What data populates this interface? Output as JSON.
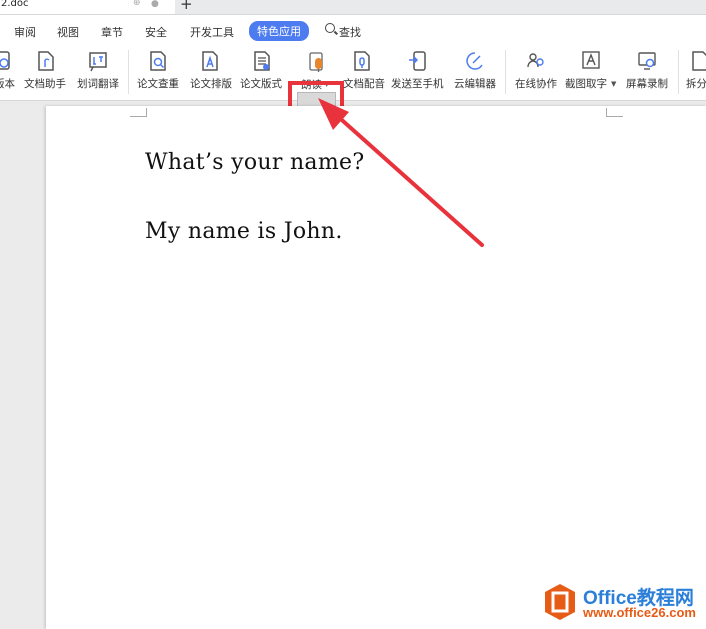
{
  "window": {
    "doc_tab_title": "2.doc",
    "new_tab_label": "+"
  },
  "menu": [
    "审阅",
    "视图",
    "章节",
    "安全",
    "开发工具",
    "特色应用",
    "查找"
  ],
  "ribbon": {
    "items": [
      {
        "label": "版本",
        "icon": "version-icon"
      },
      {
        "label": "文档助手",
        "icon": "document-assistant-icon"
      },
      {
        "label": "划词翻译",
        "icon": "word-translate-icon"
      },
      {
        "label": "论文查重",
        "icon": "paper-check-icon"
      },
      {
        "label": "论文排版",
        "icon": "paper-layout-icon"
      },
      {
        "label": "论文版式",
        "icon": "paper-format-icon"
      },
      {
        "label": "朗读",
        "icon": "read-aloud-icon"
      },
      {
        "label": "文档配音",
        "icon": "document-dubbing-icon"
      },
      {
        "label": "发送至手机",
        "icon": "send-to-phone-icon"
      },
      {
        "label": "云编辑器",
        "icon": "cloud-editor-icon"
      },
      {
        "label": "在线协作",
        "icon": "online-collaboration-icon"
      },
      {
        "label": "截图取字",
        "icon": "screenshot-ocr-icon"
      },
      {
        "label": "屏幕录制",
        "icon": "screen-record-icon"
      },
      {
        "label": "拆分",
        "icon": "split-icon"
      }
    ]
  },
  "document": {
    "lines": [
      "What’s your name?",
      "My name is John."
    ]
  },
  "watermark": {
    "name": "Office教程网",
    "url": "www.office26.com"
  },
  "colors": {
    "accent": "#4d7cf0",
    "highlight": "#e8323c",
    "brand_blue": "#2b7fd8",
    "brand_orange": "#e65b16"
  }
}
